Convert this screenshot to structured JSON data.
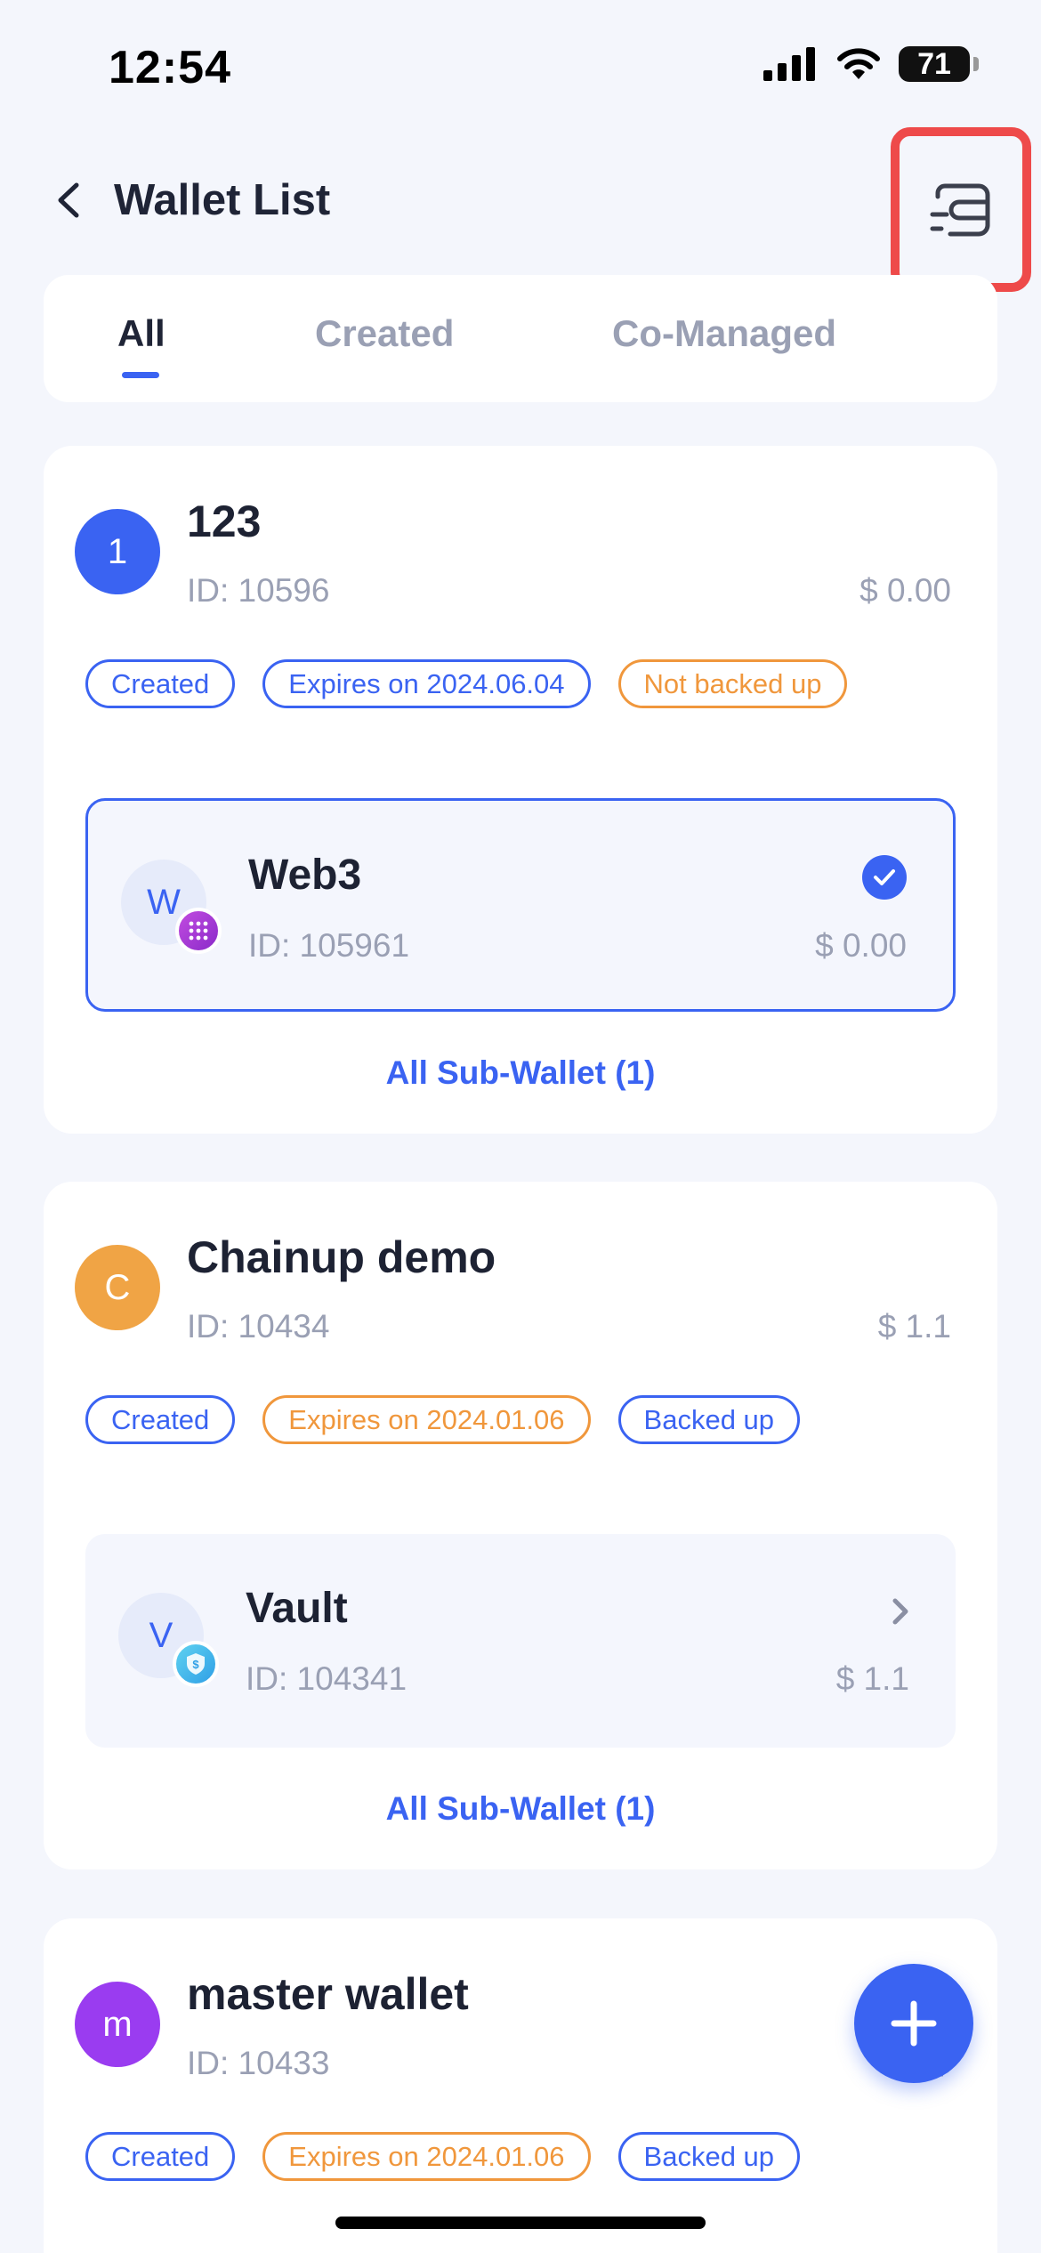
{
  "status_bar": {
    "time": "12:54",
    "battery": "71"
  },
  "header": {
    "title": "Wallet List"
  },
  "tabs": [
    {
      "label": "All",
      "active": true
    },
    {
      "label": "Created",
      "active": false
    },
    {
      "label": "Co-Managed",
      "active": false
    }
  ],
  "wallets": [
    {
      "avatar_letter": "1",
      "avatar_color": "#3a63f2",
      "name": "123",
      "id": "ID: 10596",
      "balance": "$ 0.00",
      "tags": [
        {
          "label": "Created",
          "color": "blue"
        },
        {
          "label": "Expires on 2024.06.04",
          "color": "blue"
        },
        {
          "label": "Not backed up",
          "color": "orange"
        }
      ],
      "sub_wallet": {
        "avatar_letter": "W",
        "name": "Web3",
        "id": "ID: 105961",
        "balance": "$ 0.00",
        "selected": true,
        "badge_icon": "web3-badge-icon"
      },
      "all_sub_label": "All Sub-Wallet (1)"
    },
    {
      "avatar_letter": "C",
      "avatar_color": "#f0a445",
      "name": "Chainup demo",
      "id": "ID: 10434",
      "balance": "$ 1.1",
      "tags": [
        {
          "label": "Created",
          "color": "blue"
        },
        {
          "label": "Expires on 2024.01.06",
          "color": "orange"
        },
        {
          "label": "Backed up",
          "color": "blue"
        }
      ],
      "sub_wallet": {
        "avatar_letter": "V",
        "name": "Vault",
        "id": "ID: 104341",
        "balance": "$ 1.1",
        "selected": false,
        "badge_icon": "vault-badge-icon"
      },
      "all_sub_label": "All Sub-Wallet (1)"
    },
    {
      "avatar_letter": "m",
      "avatar_color": "#9a3cf0",
      "name": "master wallet",
      "id": "ID: 10433",
      "balance": "$",
      "tags": [
        {
          "label": "Created",
          "color": "blue"
        },
        {
          "label": "Expires on 2024.01.06",
          "color": "orange"
        },
        {
          "label": "Backed up",
          "color": "blue"
        }
      ]
    }
  ],
  "colors": {
    "accent": "#3a63f2",
    "warning": "#f0973c",
    "highlight_box": "#ee4a4a"
  }
}
